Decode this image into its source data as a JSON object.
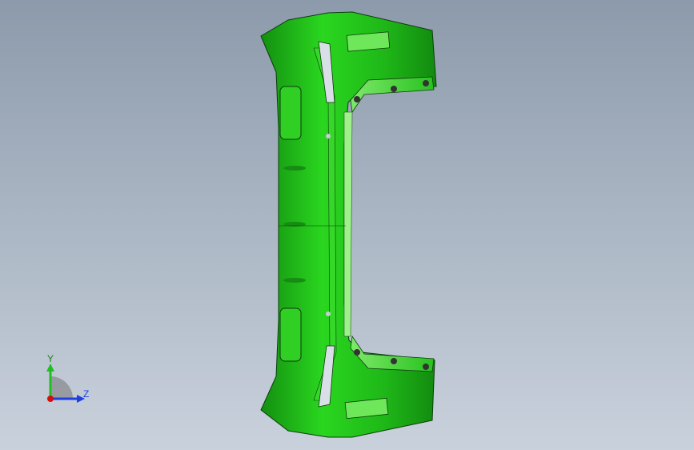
{
  "viewport": {
    "background_top": "#8c9aab",
    "background_bottom": "#c9d1dc"
  },
  "model": {
    "part_color": "#22c41a",
    "edge_color": "#0c3a0c"
  },
  "triad": {
    "y_label": "Y",
    "z_label": "Z",
    "y_color": "#1fbf1f",
    "z_color": "#1f3fdf",
    "origin_color": "#d01010"
  }
}
